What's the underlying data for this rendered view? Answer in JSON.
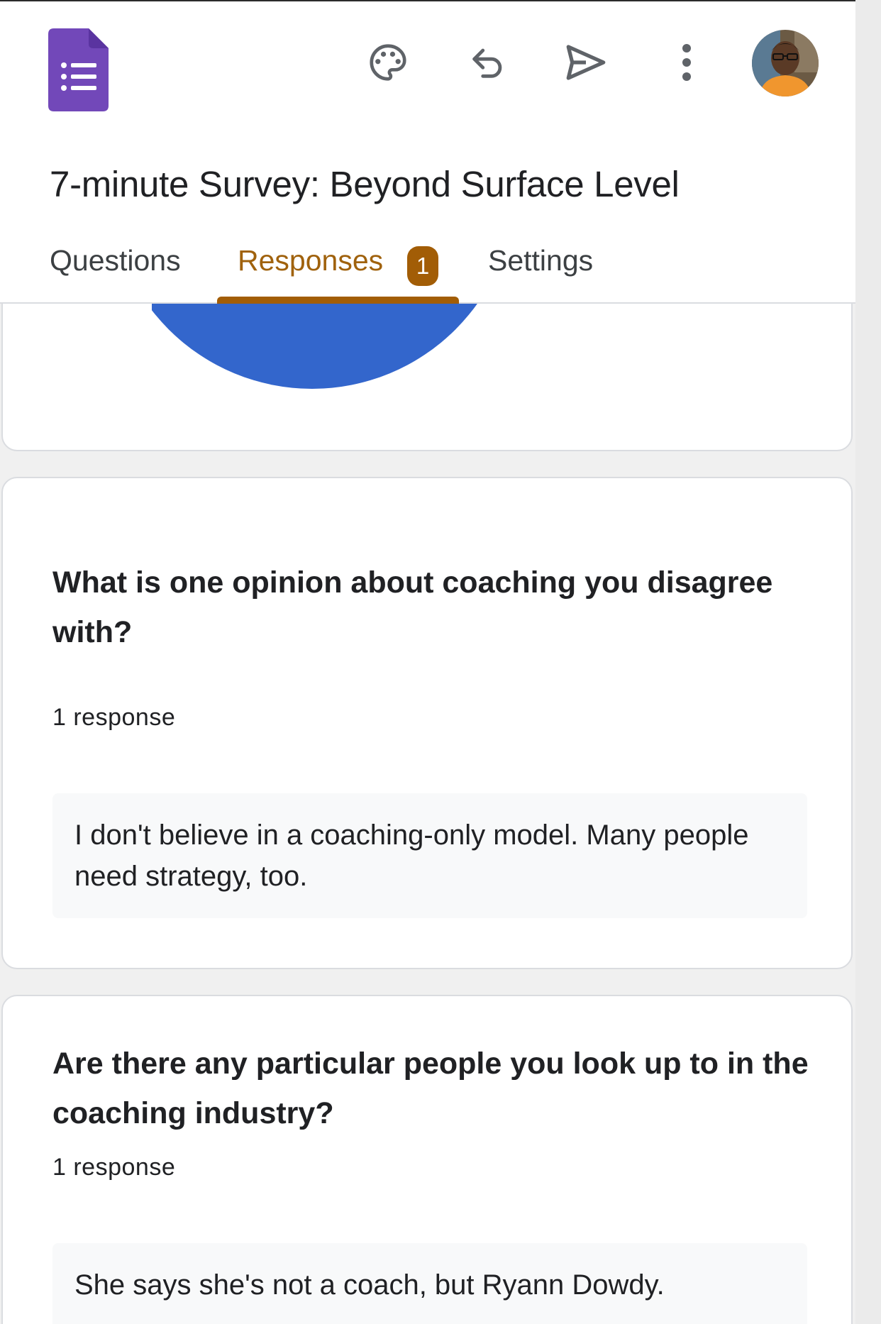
{
  "app": {
    "icons": {
      "logo": "google-forms-logo",
      "theme": "palette-icon",
      "undo": "undo-icon",
      "send": "send-icon",
      "more": "more-vert-icon",
      "avatar": "user-avatar"
    }
  },
  "header": {
    "title": "7-minute Survey: Beyond Surface Level",
    "tabs": [
      {
        "label": "Questions",
        "active": false
      },
      {
        "label": "Responses",
        "active": true,
        "badge": "1"
      },
      {
        "label": "Settings",
        "active": false
      }
    ]
  },
  "colors": {
    "accent": "#a25d06",
    "forms_purple": "#7248b9",
    "pie_blue": "#3366cc"
  },
  "chart_data": {
    "type": "pie",
    "slices": [
      {
        "value": 100,
        "color": "#3366cc"
      }
    ]
  },
  "questions": [
    {
      "question": "What is one opinion about coaching you disagree with?",
      "response_count": "1 response",
      "answers": [
        "I don't believe in a coaching-only model. Many people need strategy, too."
      ]
    },
    {
      "question": "Are there any particular people you look up to in the coaching industry?",
      "response_count": "1 response",
      "answers": [
        "She says she's not a coach, but Ryann Dowdy."
      ]
    }
  ]
}
